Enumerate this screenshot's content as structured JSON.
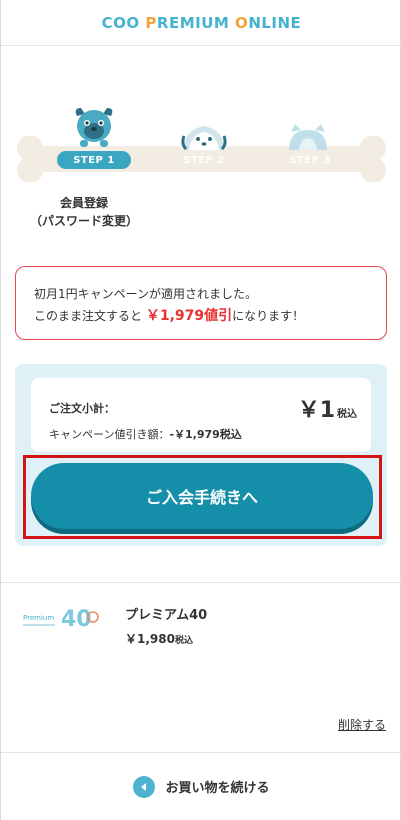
{
  "header": {
    "logo_part1": "COO ",
    "logo_p": "P",
    "logo_part2": "REMIUM ",
    "logo_o": "O",
    "logo_part3": "NLINE"
  },
  "steps": {
    "step1": "STEP 1",
    "step2": "STEP 2",
    "step3": "STEP 3",
    "caption_line1": "会員登録",
    "caption_line2": "（パスワード変更）"
  },
  "campaign": {
    "line1": "初月1円キャンペーンが適用されました。",
    "line2_prefix": "このまま注文すると",
    "discount": "￥1,979値引",
    "line2_suffix": "になります！"
  },
  "summary": {
    "subtotal_label": "ご注文小計：",
    "subtotal_value": "￥1",
    "subtotal_tax": "税込",
    "discount_label": "キャンペーン値引き額：",
    "discount_value": "-￥1,979税込"
  },
  "cta": {
    "label": "ご入会手続きへ"
  },
  "product": {
    "logo_text": "Premium",
    "logo_number": "40",
    "name": "プレミアム40",
    "price": "￥1,980",
    "price_tax": "税込",
    "delete_label": "削除する"
  },
  "footer": {
    "continue_label": "お買い物を続ける"
  },
  "colors": {
    "brand": "#45b3cf",
    "cta": "#158eaa",
    "alert": "#e8474f",
    "highlight_box": "#d41515"
  }
}
